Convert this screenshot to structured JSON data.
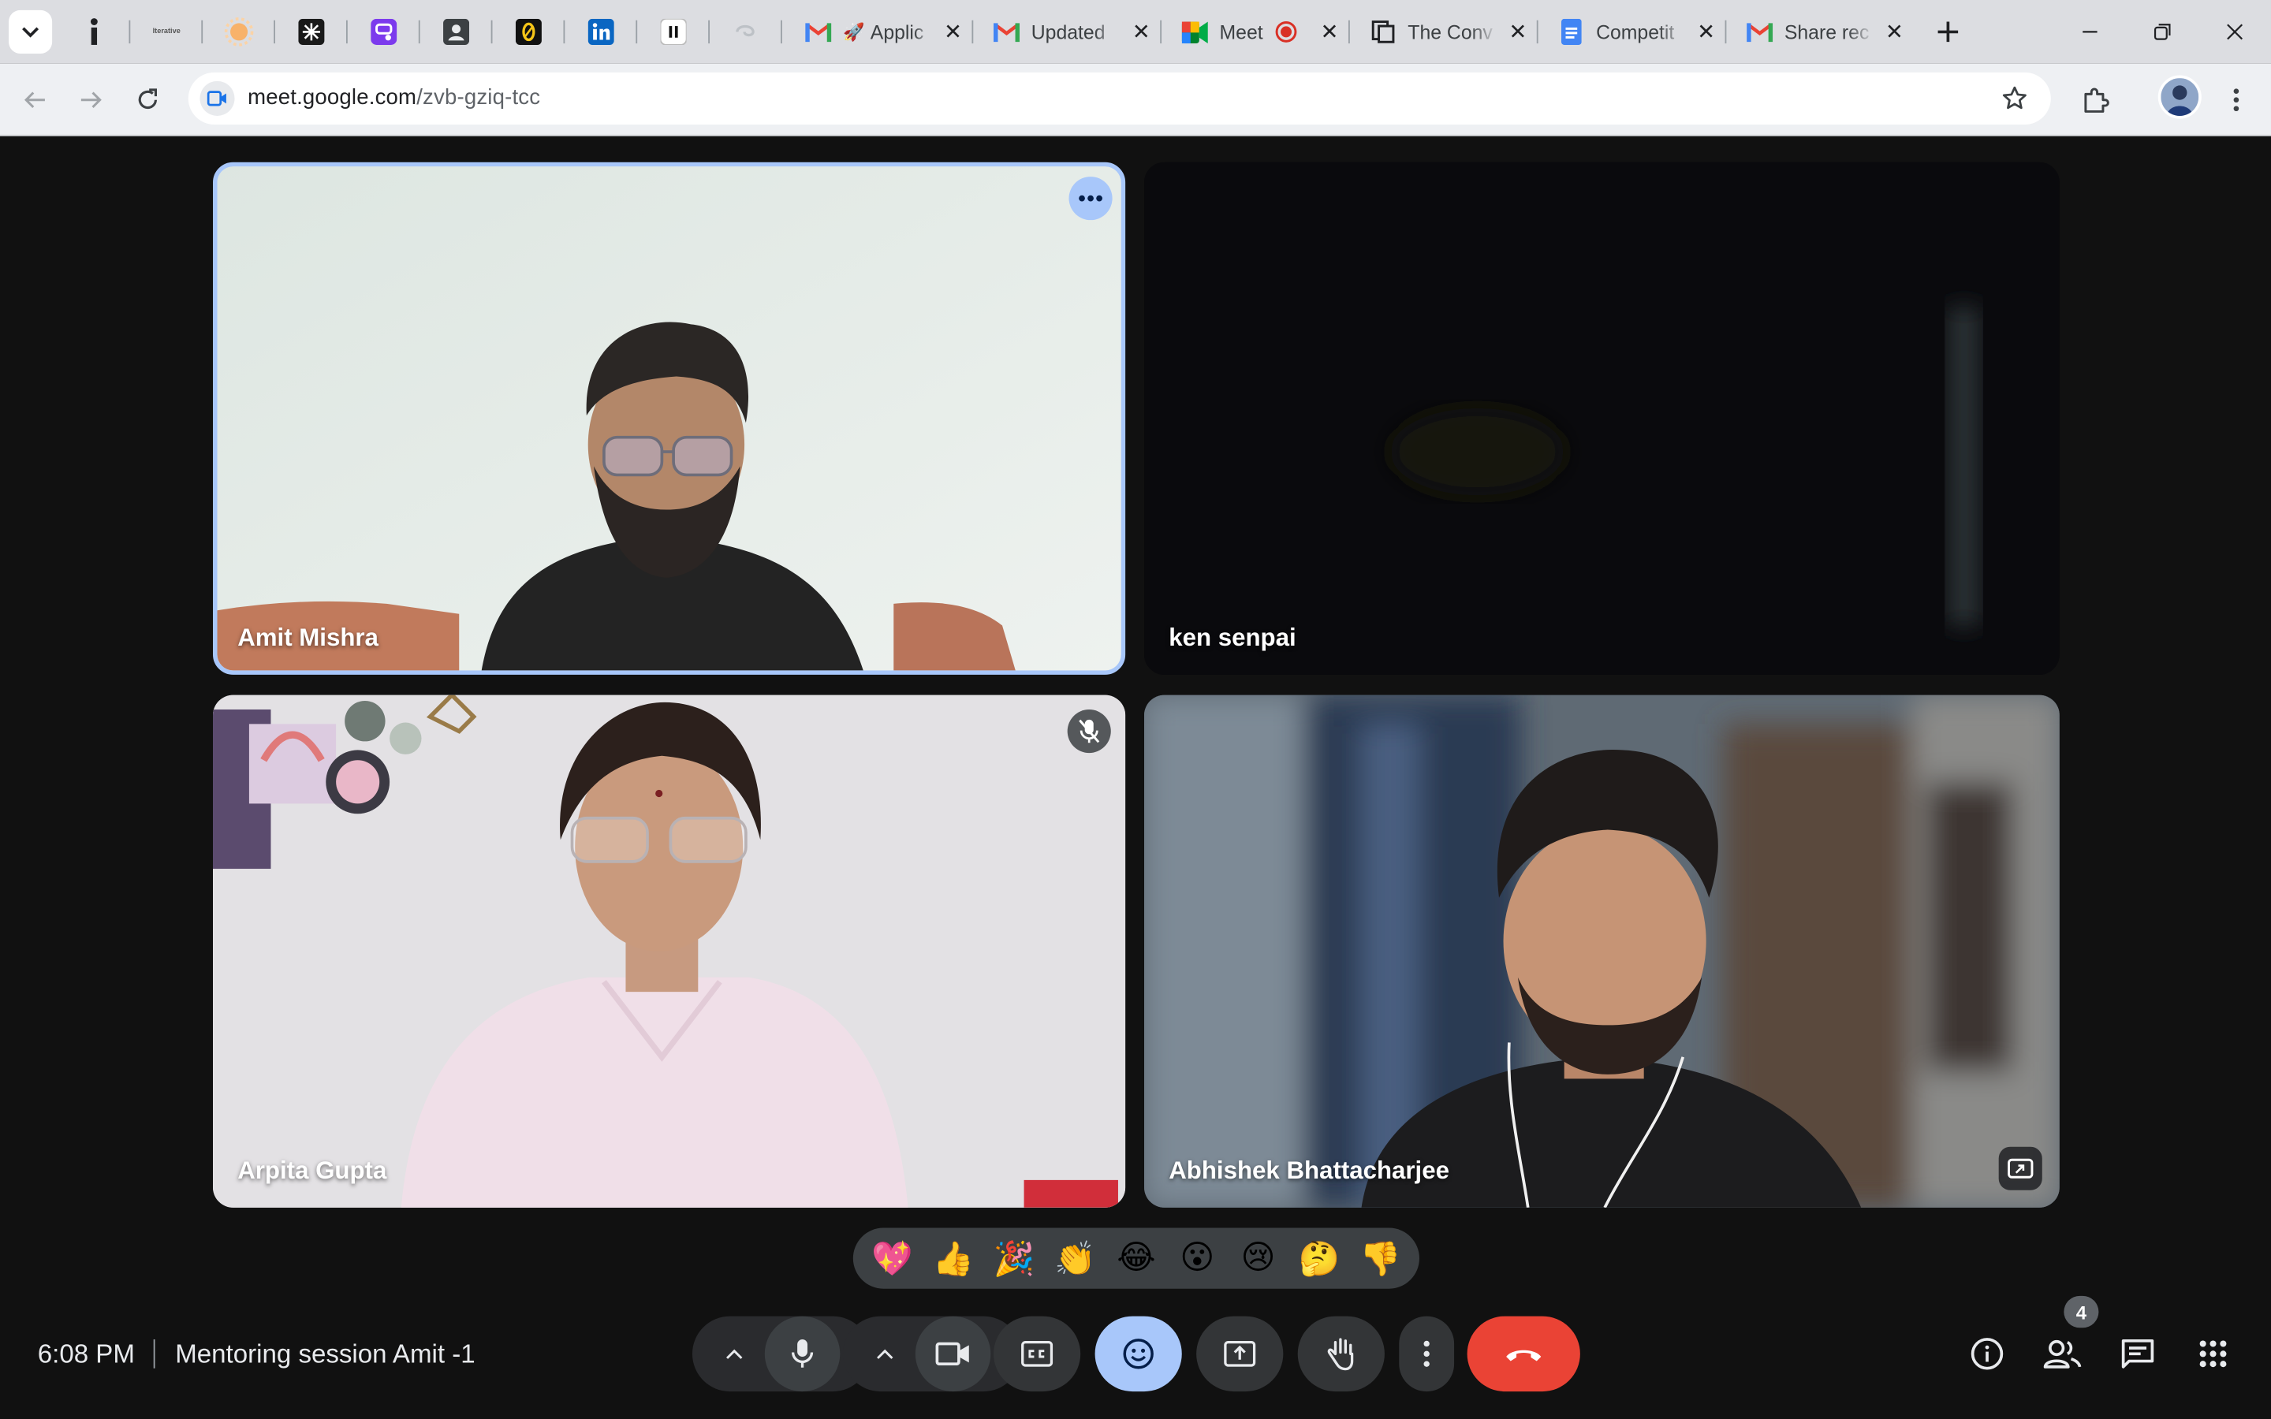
{
  "browser": {
    "tabs": [
      {
        "title": "Applic",
        "icon": "gmail-icon"
      },
      {
        "title": "Updated",
        "icon": "gmail-icon"
      },
      {
        "title": "Meet",
        "icon": "meet-icon",
        "recording": true
      },
      {
        "title": "The Conv",
        "icon": "document-outline-icon"
      },
      {
        "title": "Competit",
        "icon": "google-docs-icon"
      },
      {
        "title": "Share rec",
        "icon": "gmail-icon"
      }
    ],
    "pinned_icons": [
      "info-icon",
      "iterative-logo-icon",
      "orange-sun-icon",
      "starburst-icon",
      "purple-app-icon",
      "contact-card-icon",
      "zero-app-icon",
      "linkedin-icon",
      "pause-icon",
      "swirl-icon"
    ],
    "pinned_label": "Iterative",
    "url_domain": "meet.google.com",
    "url_path": "/zvb-gziq-tcc"
  },
  "participants": [
    {
      "name": "Amit Mishra",
      "active_speaker": true
    },
    {
      "name": "ken senpai",
      "camera": "dark"
    },
    {
      "name": "Arpita Gupta",
      "muted": true
    },
    {
      "name": "Abhishek Bhattacharjee",
      "screen": "picture-in-picture"
    }
  ],
  "reactions": [
    "💖",
    "👍",
    "🎉",
    "👏",
    "😂",
    "😮",
    "😢",
    "🤔",
    "👎"
  ],
  "meeting": {
    "time": "6:08 PM",
    "title": "Mentoring session Amit -1"
  },
  "controls": {
    "people_count": "4"
  },
  "colors": {
    "background": "#111111",
    "active_border": "#a8c7fa",
    "end_call": "#ea4335",
    "control_bg": "#333537"
  }
}
